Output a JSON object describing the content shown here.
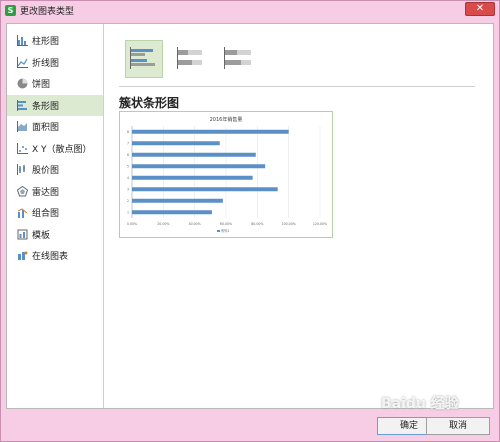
{
  "window": {
    "title": "更改图表类型",
    "close_symbol": "✕"
  },
  "sidebar": {
    "items": [
      {
        "label": "柱形图",
        "icon": "column-chart-icon"
      },
      {
        "label": "折线图",
        "icon": "line-chart-icon"
      },
      {
        "label": "饼图",
        "icon": "pie-chart-icon"
      },
      {
        "label": "条形图",
        "icon": "bar-chart-icon",
        "selected": true
      },
      {
        "label": "面积图",
        "icon": "area-chart-icon"
      },
      {
        "label": "X Y（散点图）",
        "icon": "scatter-chart-icon"
      },
      {
        "label": "股价图",
        "icon": "stock-chart-icon"
      },
      {
        "label": "雷达图",
        "icon": "radar-chart-icon"
      },
      {
        "label": "组合图",
        "icon": "combo-chart-icon"
      },
      {
        "label": "模板",
        "icon": "template-icon"
      },
      {
        "label": "在线图表",
        "icon": "online-chart-icon"
      }
    ]
  },
  "main": {
    "subtype_heading": "簇状条形图"
  },
  "chart_data": {
    "type": "bar",
    "orientation": "horizontal",
    "title": "2016年销售量",
    "categories": [
      "1",
      "2",
      "3",
      "4",
      "5",
      "6",
      "7",
      "8"
    ],
    "values": [
      0.51,
      0.58,
      0.93,
      0.77,
      0.85,
      0.79,
      0.56,
      1.0
    ],
    "xlim": [
      0,
      1.2
    ],
    "xticks": [
      "0.00%",
      "20.00%",
      "40.00%",
      "60.00%",
      "80.00%",
      "100.00%",
      "120.00%"
    ],
    "legend": "系列1",
    "bar_color": "#5b8fc7",
    "grid": true
  },
  "footer": {
    "ok_label": "确定",
    "cancel_label": "取消"
  },
  "watermark": "Baidu 经验"
}
